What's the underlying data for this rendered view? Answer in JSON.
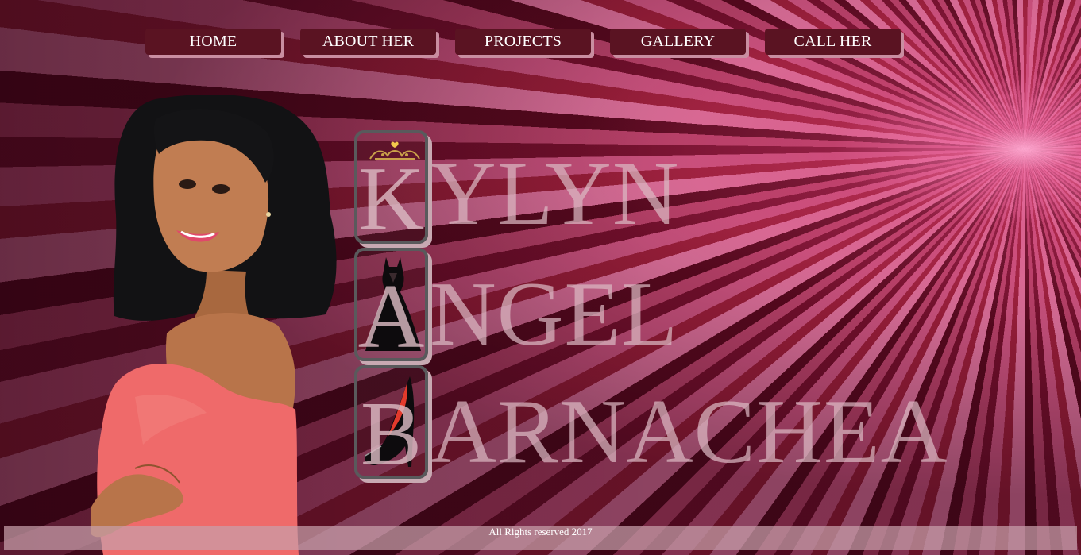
{
  "nav": {
    "items": [
      {
        "label": "HOME"
      },
      {
        "label": "ABOUT HER"
      },
      {
        "label": "PROJECTS"
      },
      {
        "label": "GALLERY"
      },
      {
        "label": "CALL HER"
      }
    ]
  },
  "name": {
    "lines": [
      {
        "initial": "K",
        "rest": "YLYN",
        "emblem": "tiara-icon"
      },
      {
        "initial": "A",
        "rest": "NGEL",
        "emblem": "dress-icon"
      },
      {
        "initial": "B",
        "rest": "ARNACHEA",
        "emblem": "high-heel-icon"
      }
    ]
  },
  "footer": {
    "text": "All Rights reserved 2017"
  },
  "colors": {
    "nav_button_bg": "#5a1322",
    "nav_button_shadow": "#c98ea1",
    "letter_box_border": "#595a5c",
    "footer_bg": "#c8a0aa",
    "sunburst_center": "#f07aa8",
    "sunburst_dark": "#5f0a21"
  }
}
